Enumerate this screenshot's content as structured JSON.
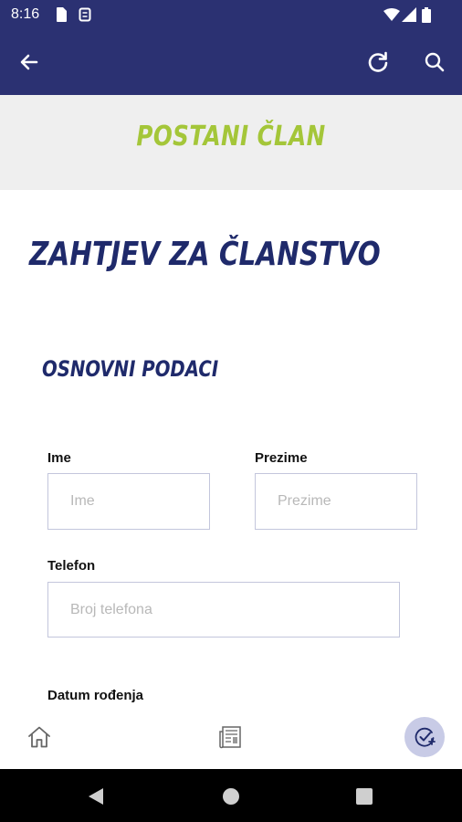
{
  "status_bar": {
    "time": "8:16"
  },
  "banner": {
    "title": "POSTANI ČLAN"
  },
  "page": {
    "title": "ZAHTJEV ZA ČLANSTVO",
    "section_title": "OSNOVNI PODACI"
  },
  "form": {
    "first_name": {
      "label": "Ime",
      "placeholder": "Ime",
      "value": ""
    },
    "last_name": {
      "label": "Prezime",
      "placeholder": "Prezime",
      "value": ""
    },
    "phone": {
      "label": "Telefon",
      "placeholder": "Broj telefona",
      "value": ""
    },
    "birth_date": {
      "label": "Datum rođenja"
    }
  },
  "colors": {
    "header_bg": "#2b3172",
    "accent_green": "#a4c639",
    "title_navy": "#1f2a6b",
    "banner_bg": "#efefef",
    "fab_bg": "#c8cbe6"
  },
  "icons": {
    "back": "arrow-left-icon",
    "refresh": "refresh-icon",
    "search": "search-icon",
    "home": "home-icon",
    "news": "newspaper-icon",
    "fab": "membership-check-icon"
  }
}
